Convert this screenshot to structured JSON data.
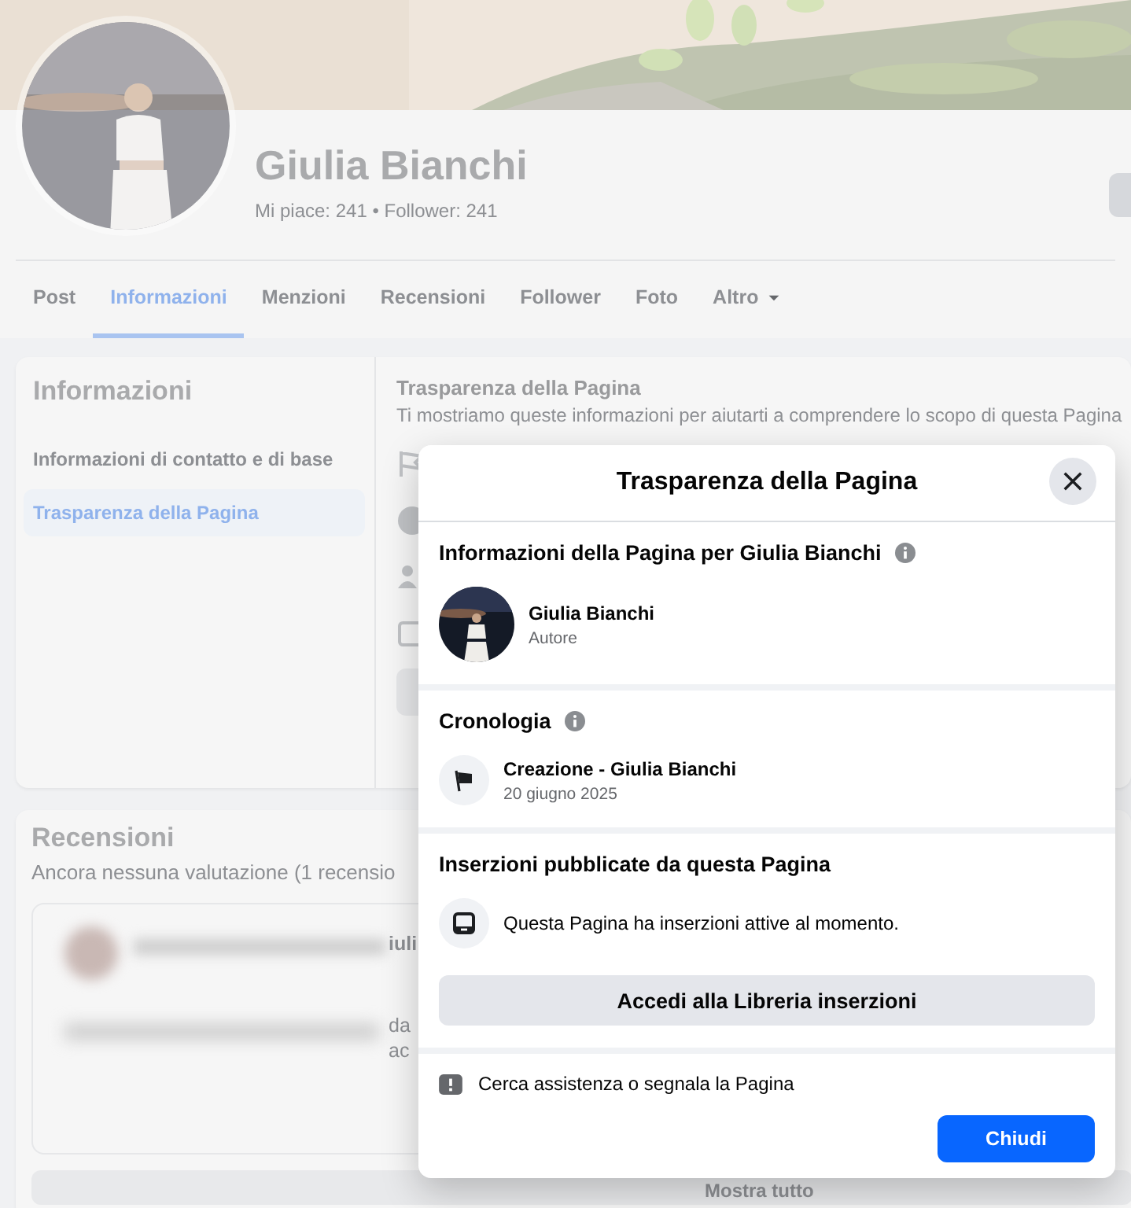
{
  "profile": {
    "name": "Giulia Bianchi",
    "stats": "Mi piace: 241 • Follower: 241"
  },
  "tabs": [
    {
      "label": "Post",
      "selected": false,
      "menu": false
    },
    {
      "label": "Informazioni",
      "selected": true,
      "menu": false
    },
    {
      "label": "Menzioni",
      "selected": false,
      "menu": false
    },
    {
      "label": "Recensioni",
      "selected": false,
      "menu": false
    },
    {
      "label": "Follower",
      "selected": false,
      "menu": false
    },
    {
      "label": "Foto",
      "selected": false,
      "menu": false
    },
    {
      "label": "Altro",
      "selected": false,
      "menu": true
    }
  ],
  "about_sidebar": {
    "title": "Informazioni",
    "items": [
      {
        "label": "Informazioni di contatto e di base",
        "selected": false
      },
      {
        "label": "Trasparenza della Pagina",
        "selected": true
      }
    ]
  },
  "transparency_panel": {
    "title": "Trasparenza della Pagina",
    "description": "Ti mostriamo queste informazioni per aiutarti a comprendere lo scopo di questa Pagina"
  },
  "reviews": {
    "title": "Recensioni",
    "summary": "Ancora nessuna valutazione (1 recensio",
    "fragments": [
      "iuli",
      "da",
      "ac"
    ],
    "show_all": "Mostra tutto"
  },
  "dialog": {
    "title": "Trasparenza della Pagina",
    "page_info": {
      "heading": "Informazioni della Pagina per Giulia Bianchi",
      "owner_name": "Giulia Bianchi",
      "owner_role": "Autore"
    },
    "history": {
      "heading": "Cronologia",
      "events": [
        {
          "title": "Creazione - Giulia Bianchi",
          "date": "20 giugno 2025"
        }
      ]
    },
    "ads": {
      "heading": "Inserzioni pubblicate da questa Pagina",
      "status": "Questa Pagina ha inserzioni attive al momento.",
      "library_button": "Accedi alla Libreria inserzioni"
    },
    "report_link": "Cerca assistenza o segnala la Pagina",
    "close_button": "Chiudi"
  }
}
